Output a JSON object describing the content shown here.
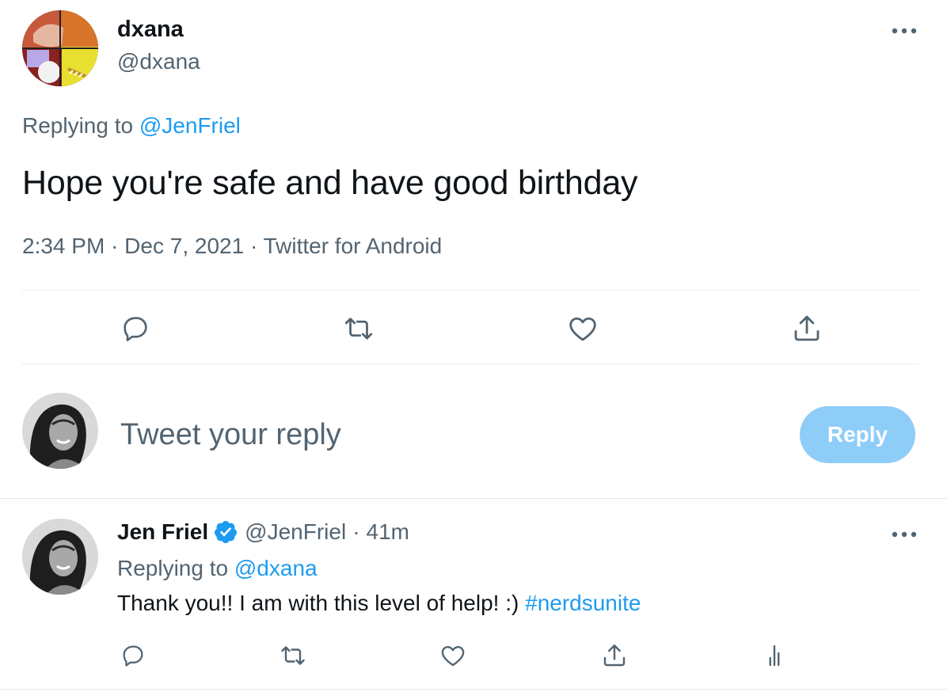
{
  "main_tweet": {
    "author_name": "dxana",
    "author_handle": "@dxana",
    "replying_label": "Replying to",
    "replying_to": "@JenFriel",
    "text": "Hope you're safe and have good birthday",
    "time": "2:34 PM",
    "date": "Dec 7, 2021",
    "source": "Twitter for Android",
    "separator": "·",
    "actions": [
      "reply-icon",
      "retweet-icon",
      "like-icon",
      "share-icon"
    ]
  },
  "composer": {
    "placeholder": "Tweet your reply",
    "button_label": "Reply",
    "button_color": "#8ecdf8"
  },
  "reply_tweet": {
    "author_name": "Jen Friel",
    "verified": true,
    "author_handle": "@JenFriel",
    "age": "41m",
    "replying_label": "Replying to",
    "replying_to": "@dxana",
    "text": "Thank you!! I am with this level of help! :)",
    "hashtag": "#nerdsunite",
    "actions": [
      "reply-icon",
      "retweet-icon",
      "like-icon",
      "share-icon",
      "analytics-icon"
    ]
  },
  "colors": {
    "link": "#1d9bf0",
    "muted": "#536471",
    "text": "#0f1419",
    "divider": "#e6ecf0"
  }
}
